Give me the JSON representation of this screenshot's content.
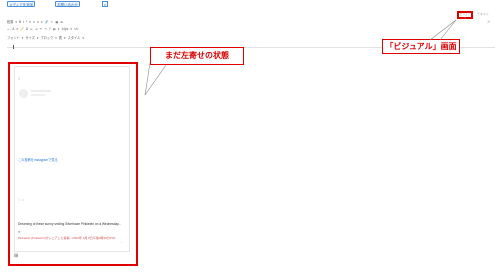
{
  "topbar": {
    "add_media_label": "メディアを追加",
    "add_form_label": "お問い合わせ",
    "x_label": "x"
  },
  "editor_tabs": {
    "visual_label": "ビジュアル",
    "text_label": "テキスト"
  },
  "toolbar": {
    "row1": [
      "段落",
      "▾",
      "B",
      "I",
      "ᵟ",
      "≡",
      "≡",
      "≡",
      "≡",
      "🔗",
      "✂",
      "▦",
      "⊞"
    ],
    "row2": [
      "—",
      "A",
      "▾",
      "🧹",
      "Ω",
      "⇤",
      "⇥",
      "↶",
      "↷",
      "?",
      "▤",
      "▾",
      "14px",
      "▾",
      "</>"
    ],
    "row3": [
      "フォント",
      "▾",
      "サイズ",
      "▾",
      "ブロック",
      "▾",
      "表",
      "▾",
      "スタイル",
      "▾"
    ]
  },
  "annotations": {
    "left_callout": "まだ左寄せの状態",
    "right_callout": "「ビジュアル」画面"
  },
  "embed": {
    "top_mark": "≡",
    "view_link": "この投稿をInstagramで見る",
    "icons": "♡ ○",
    "caption": "Dreaming of these sunny smiling Silverhaze Pinkiebtn on a Wednesday...",
    "caption_link": "Pinkiebtn",
    "pin_icon": "⌕",
    "caption2": "Pinkiebtn (Pinkiebtn)がシェアした投稿 - 2023年 3月 8日午後4時39分PST",
    "corner_mark": "⌟"
  },
  "bottom": {
    "icon": "⊞"
  },
  "colors": {
    "highlight": "#e00000",
    "link": "#2a7bd6",
    "button_border": "#4a90d9"
  }
}
